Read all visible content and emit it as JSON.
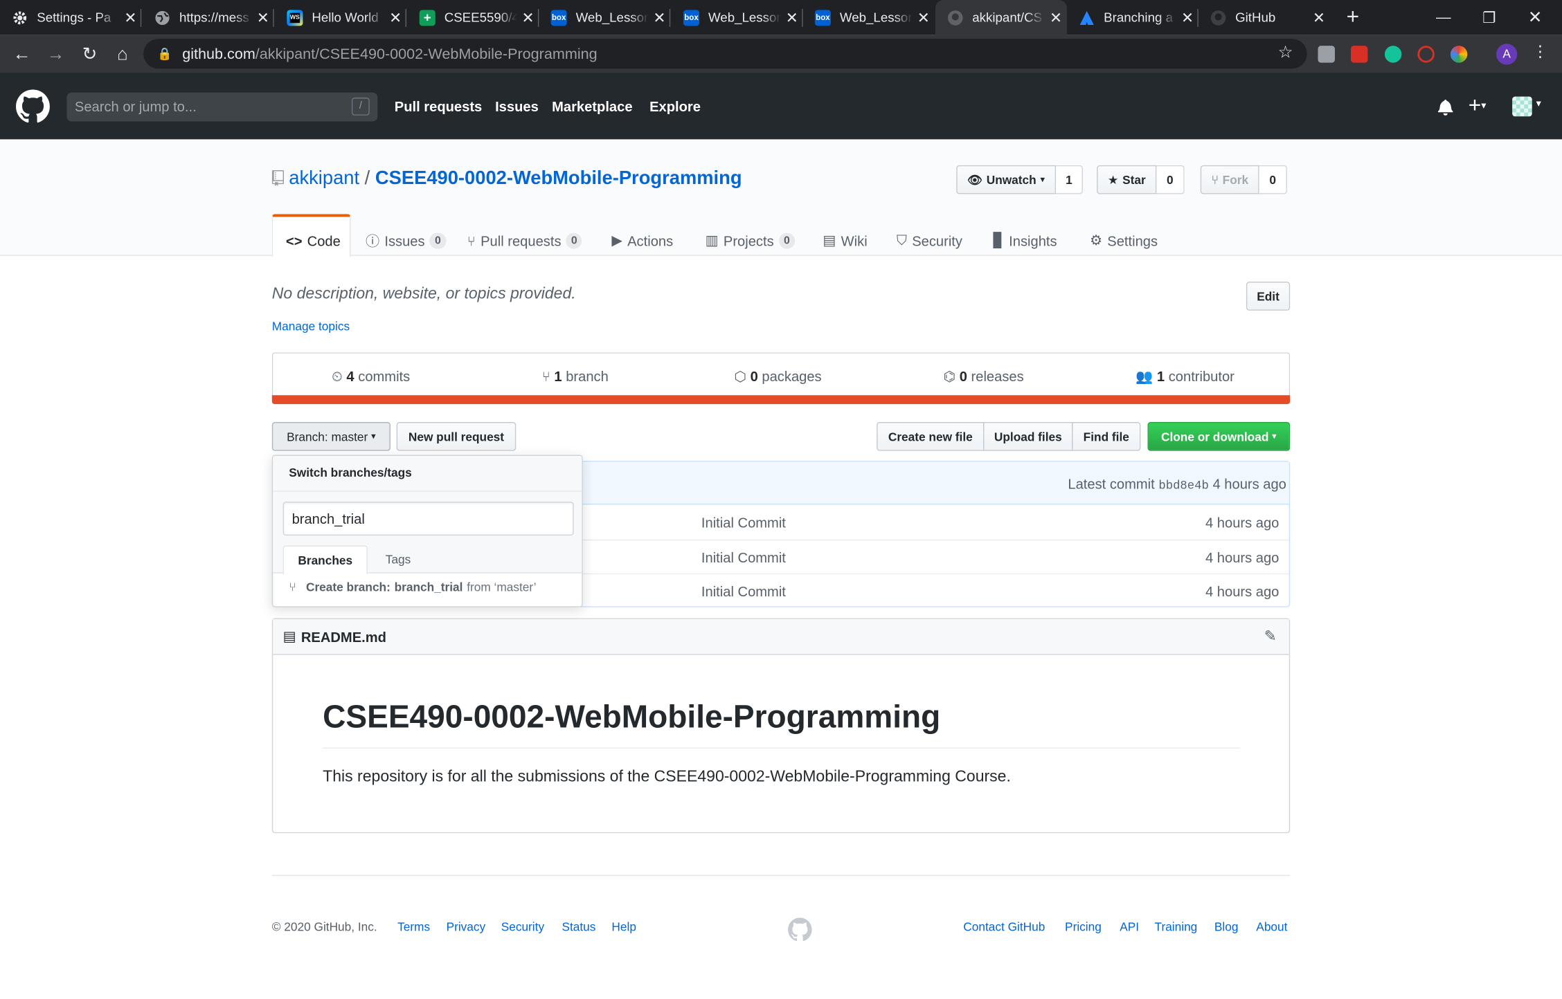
{
  "browser": {
    "tabs": [
      {
        "title": "Settings - Pa",
        "icon": "gear-icon",
        "active": false
      },
      {
        "title": "https://mess",
        "icon": "globe-icon",
        "active": false
      },
      {
        "title": "Hello World",
        "icon": "webstorm-icon",
        "active": false
      },
      {
        "title": "CSEE5590/4",
        "icon": "sheets-icon",
        "active": false
      },
      {
        "title": "Web_Lesson",
        "icon": "box-icon",
        "active": false
      },
      {
        "title": "Web_Lesson",
        "icon": "box-icon",
        "active": false
      },
      {
        "title": "Web_Lesson",
        "icon": "box-icon",
        "active": false
      },
      {
        "title": "akkipant/CS",
        "icon": "github-icon",
        "active": true
      },
      {
        "title": "Branching a",
        "icon": "atlassian-icon",
        "active": false
      },
      {
        "title": "GitHub",
        "icon": "github-icon",
        "active": false
      }
    ],
    "new_tab": "+",
    "url_host": "github.com",
    "url_path": "/akkipant/CSEE490-0002-WebMobile-Programming",
    "profile_letter": "A"
  },
  "header": {
    "search_placeholder": "Search or jump to...",
    "search_shortcut": "/",
    "nav": [
      "Pull requests",
      "Issues",
      "Marketplace",
      "Explore"
    ]
  },
  "repo": {
    "owner": "akkipant",
    "separator": "/",
    "name": "CSEE490-0002-WebMobile-Programming",
    "watch_label": "Unwatch",
    "watch_count": "1",
    "star_label": "Star",
    "star_count": "0",
    "fork_label": "Fork",
    "fork_count": "0",
    "tabs": [
      {
        "label": "Code",
        "count": null
      },
      {
        "label": "Issues",
        "count": "0"
      },
      {
        "label": "Pull requests",
        "count": "0"
      },
      {
        "label": "Actions",
        "count": null
      },
      {
        "label": "Projects",
        "count": "0"
      },
      {
        "label": "Wiki",
        "count": null
      },
      {
        "label": "Security",
        "count": null
      },
      {
        "label": "Insights",
        "count": null
      },
      {
        "label": "Settings",
        "count": null
      }
    ]
  },
  "about": {
    "description": "No description, website, or topics provided.",
    "edit_label": "Edit",
    "manage_topics": "Manage topics"
  },
  "summary": {
    "commits_num": "4",
    "commits_label": "commits",
    "branch_num": "1",
    "branch_label": "branch",
    "packages_num": "0",
    "packages_label": "packages",
    "releases_num": "0",
    "releases_label": "releases",
    "contributor_num": "1",
    "contributor_label": "contributor",
    "language_color": "#e34c26"
  },
  "toolbar": {
    "branch_label": "Branch:",
    "branch_value": "master",
    "new_pr": "New pull request",
    "create_file": "Create new file",
    "upload_files": "Upload files",
    "find_file": "Find file",
    "clone": "Clone or download"
  },
  "commit_bar": {
    "prefix": "Latest commit",
    "sha": "bbd8e4b",
    "time": "4 hours ago"
  },
  "files": [
    {
      "message": "Initial Commit",
      "age": "4 hours ago"
    },
    {
      "message": "Initial Commit",
      "age": "4 hours ago"
    },
    {
      "message": "Initial Commit",
      "age": "4 hours ago"
    }
  ],
  "branch_menu": {
    "title": "Switch branches/tags",
    "filter_value": "branch_trial",
    "tab_branches": "Branches",
    "tab_tags": "Tags",
    "create_prefix": "Create branch:",
    "create_name": "branch_trial",
    "create_from": "from ‘master’"
  },
  "readme": {
    "filename": "README.md",
    "heading": "CSEE490-0002-WebMobile-Programming",
    "body": "This repository is for all the submissions of the CSEE490-0002-WebMobile-Programming Course."
  },
  "footer": {
    "copyright": "© 2020 GitHub, Inc.",
    "left_links": [
      "Terms",
      "Privacy",
      "Security",
      "Status",
      "Help"
    ],
    "right_links": [
      "Contact GitHub",
      "Pricing",
      "API",
      "Training",
      "Blog",
      "About"
    ]
  }
}
